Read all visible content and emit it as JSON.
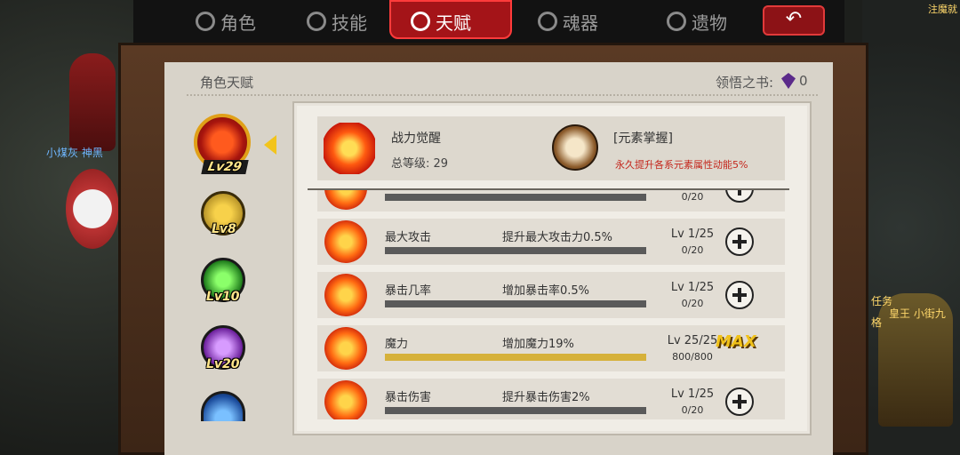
{
  "tabs": [
    {
      "label": "角色",
      "icon": "character-icon",
      "active": false
    },
    {
      "label": "技能",
      "icon": "skill-icon",
      "active": false
    },
    {
      "label": "天赋",
      "icon": "talent-icon",
      "active": true
    },
    {
      "label": "魂器",
      "icon": "soul-vessel-icon",
      "active": false
    },
    {
      "label": "遗物",
      "icon": "relic-icon",
      "active": false
    }
  ],
  "back_button": {
    "icon": "back-arrow-icon"
  },
  "background_labels": {
    "left_name": "小煤灰 神黑",
    "right_task": "任务",
    "right_task2": "格",
    "right_name": "皇王 小街九",
    "right_top": "注魔就 研究"
  },
  "panel": {
    "title": "角色天赋",
    "book_label": "领悟之书:",
    "book_count": "0"
  },
  "talent_icons": [
    {
      "level": "Lv29",
      "selected": true
    },
    {
      "level": "Lv8",
      "selected": false
    },
    {
      "level": "Lv10",
      "selected": false
    },
    {
      "level": "Lv20",
      "selected": false
    },
    {
      "level": "",
      "selected": false
    }
  ],
  "header": {
    "name": "战力觉醒",
    "total_level_label": "总等级:",
    "total_level_value": "29",
    "element_name": "[元素掌握]",
    "element_desc": "永久提升各系元素属性动能5%"
  },
  "rows": [
    {
      "name": "",
      "desc": "",
      "level": "",
      "progress": "0/20",
      "fill": 0,
      "max": false
    },
    {
      "name": "最大攻击",
      "desc": "提升最大攻击力0.5%",
      "level": "Lv 1/25",
      "progress": "0/20",
      "fill": 0,
      "max": false
    },
    {
      "name": "暴击几率",
      "desc": "增加暴击率0.5%",
      "level": "Lv 1/25",
      "progress": "0/20",
      "fill": 0,
      "max": false
    },
    {
      "name": "魔力",
      "desc": "增加魔力19%",
      "level": "Lv 25/25",
      "progress": "800/800",
      "fill": 1,
      "max": true
    },
    {
      "name": "暴击伤害",
      "desc": "提升暴击伤害2%",
      "level": "Lv 1/25",
      "progress": "0/20",
      "fill": 0,
      "max": false
    }
  ],
  "max_label": "MAX",
  "colors": {
    "tab_active": "#a41418",
    "accent_gold": "#d6b13a",
    "desc_red": "#c4261c"
  }
}
